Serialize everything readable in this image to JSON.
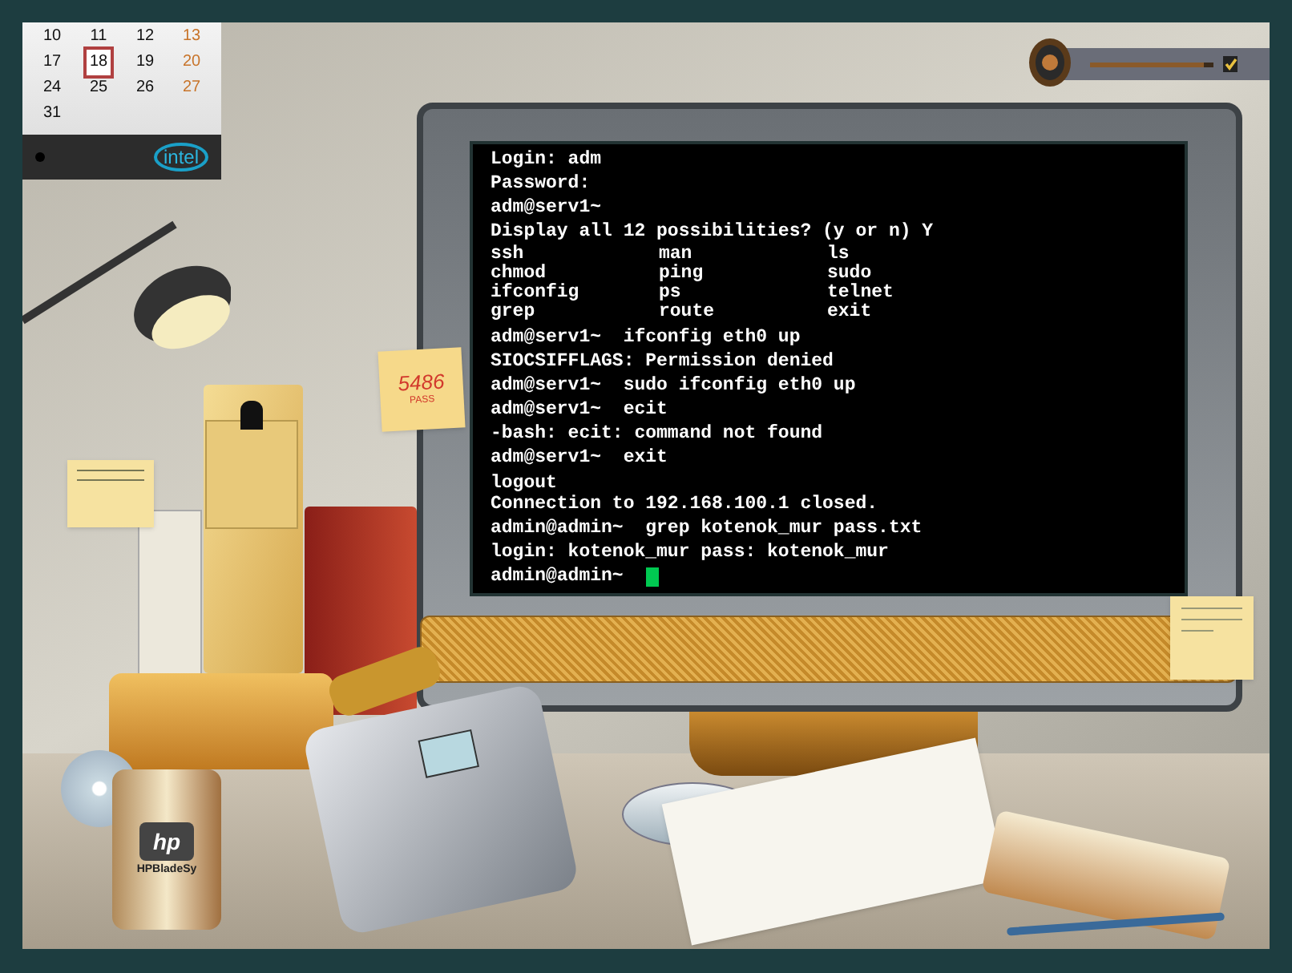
{
  "calendar": {
    "days": [
      {
        "label": "10",
        "weekend": false,
        "selected": false
      },
      {
        "label": "11",
        "weekend": false,
        "selected": false
      },
      {
        "label": "12",
        "weekend": false,
        "selected": false
      },
      {
        "label": "13",
        "weekend": true,
        "selected": false
      },
      {
        "label": "17",
        "weekend": false,
        "selected": false
      },
      {
        "label": "18",
        "weekend": false,
        "selected": true
      },
      {
        "label": "19",
        "weekend": false,
        "selected": false
      },
      {
        "label": "20",
        "weekend": true,
        "selected": false
      },
      {
        "label": "24",
        "weekend": false,
        "selected": false
      },
      {
        "label": "25",
        "weekend": false,
        "selected": false
      },
      {
        "label": "26",
        "weekend": false,
        "selected": false
      },
      {
        "label": "27",
        "weekend": true,
        "selected": false
      },
      {
        "label": "31",
        "weekend": false,
        "selected": false
      }
    ],
    "logo": "intel"
  },
  "volume": {
    "level": 0.92,
    "checked": true
  },
  "terminal": {
    "lines": [
      {
        "kind": "text",
        "text": "Login: adm"
      },
      {
        "kind": "text",
        "text": "Password:"
      },
      {
        "kind": "text",
        "text": "adm@serv1~"
      },
      {
        "kind": "text",
        "text": "Display all 12 possibilities? (y or n) Y"
      },
      {
        "kind": "columns",
        "cells": [
          "ssh",
          "man",
          "ls"
        ]
      },
      {
        "kind": "columns",
        "cells": [
          "chmod",
          "ping",
          "sudo"
        ]
      },
      {
        "kind": "columns",
        "cells": [
          "ifconfig",
          "ps",
          "telnet"
        ]
      },
      {
        "kind": "columns",
        "cells": [
          "grep",
          "route",
          "exit"
        ]
      },
      {
        "kind": "text",
        "text": "adm@serv1~  ifconfig eth0 up"
      },
      {
        "kind": "text",
        "text": "SIOCSIFFLAGS: Permission denied"
      },
      {
        "kind": "text",
        "text": "adm@serv1~  sudo ifconfig eth0 up"
      },
      {
        "kind": "text",
        "text": "adm@serv1~  ecit"
      },
      {
        "kind": "text",
        "text": "-bash: ecit: command not found"
      },
      {
        "kind": "text",
        "text": "adm@serv1~  exit"
      },
      {
        "kind": "tight",
        "text": "logout"
      },
      {
        "kind": "text",
        "text": "Connection to 192.168.100.1 closed."
      },
      {
        "kind": "text",
        "text": "admin@admin~  grep kotenok_mur pass.txt"
      },
      {
        "kind": "text",
        "text": "login: kotenok_mur pass: kotenok_mur"
      },
      {
        "kind": "prompt",
        "text": "admin@admin~"
      }
    ],
    "cursor": true
  },
  "sticky_note": {
    "number": "5486",
    "caption": "PASS"
  },
  "mug": {
    "logo": "hp",
    "label": "HPBladeSy"
  }
}
